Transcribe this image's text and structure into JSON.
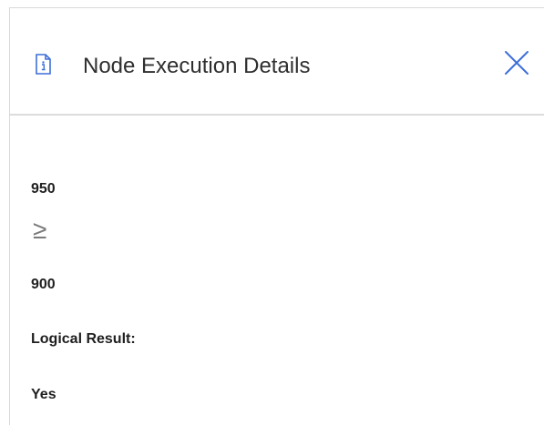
{
  "dialog": {
    "title": "Node Execution Details",
    "header_icon": "document-info-icon",
    "close_icon": "close-icon",
    "accent_color": "#3e6fd8"
  },
  "details": {
    "left_value": "950",
    "operator": "≥",
    "right_value": "900",
    "result_label": "Logical Result:",
    "result_value": "Yes"
  }
}
